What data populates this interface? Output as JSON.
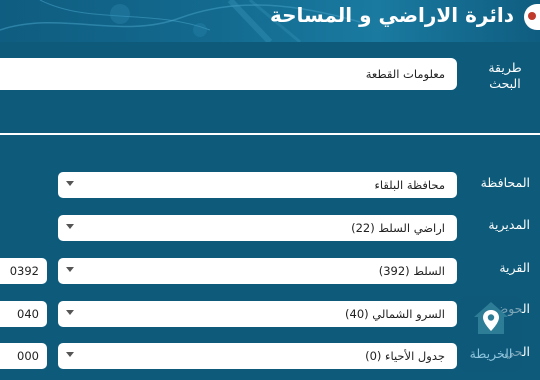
{
  "header": {
    "title": "دائرة الاراضي و المساحة"
  },
  "search": {
    "label": "طريقة البحث",
    "value": "معلومات القطعة"
  },
  "fields": {
    "governorate": {
      "label": "المحافظة",
      "value": "محافظة البلقاء"
    },
    "directorate": {
      "label": "المديرية",
      "value": "اراضي السلط (22)"
    },
    "village": {
      "label": "القرية",
      "value": "السلط (392)",
      "code": "0392"
    },
    "basin": {
      "label": "الحوض",
      "value": "السرو الشمالي (40)",
      "code": "040"
    },
    "neighborhood": {
      "label": "الحي",
      "value": "جدول الأحياء (0)",
      "code": "000"
    }
  },
  "map_widget": {
    "label": "الخريطة",
    "icon": "home-location-icon"
  },
  "colors": {
    "background": "#0e5a7a",
    "field": "#ffffff",
    "map_icon": "#2e7d96"
  }
}
